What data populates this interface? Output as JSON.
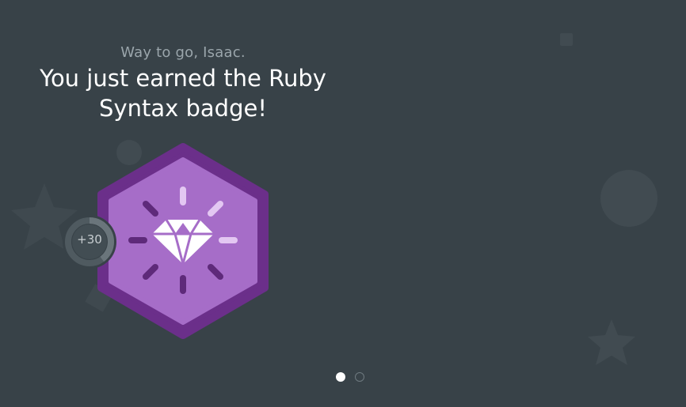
{
  "message": {
    "greeting": "Way to go, Isaac.",
    "headline": "You just earned the Ruby Syntax badge!"
  },
  "badge": {
    "icon": "gem-icon",
    "colors": {
      "outer": "#6b2f8a",
      "inner": "#a66dc8",
      "rays_dark": "#5e2a7a",
      "rays_light": "#e3c7f2",
      "gem": "#ffffff"
    }
  },
  "points": {
    "label": "+30",
    "progress_fraction": 0.4
  },
  "pager": {
    "total": 2,
    "current": 1
  },
  "colors": {
    "background": "#384248",
    "decor": "#414b51"
  }
}
